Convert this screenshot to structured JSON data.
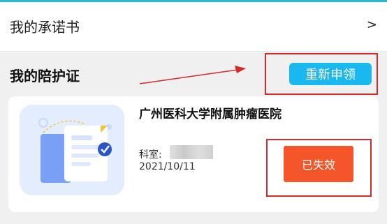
{
  "promise": {
    "title": "我的承诺书",
    "arrow": ">"
  },
  "section": {
    "title": "我的陪护证"
  },
  "reapply": {
    "label": "重新申领"
  },
  "certificate": {
    "hospital": "广州医科大学附属肿瘤医院",
    "dept_label": "科室:",
    "date": "2021/10/11",
    "status": "已失效"
  },
  "colors": {
    "accent": "#19b8f0",
    "status": "#f4562a",
    "annotation": "#d52a2a"
  }
}
